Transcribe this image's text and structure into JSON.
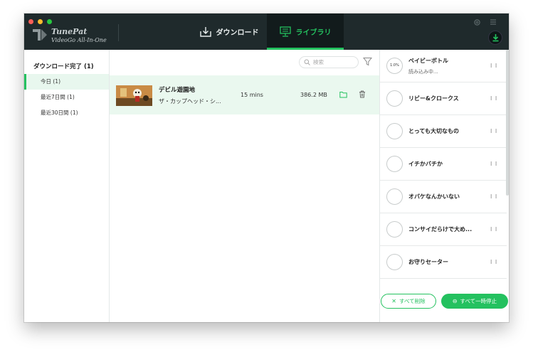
{
  "app": {
    "brand_name": "TunePat",
    "brand_sub": "VideoGo All-In-One"
  },
  "tabs": [
    {
      "label": "ダウンロード",
      "active": false
    },
    {
      "label": "ライブラリ",
      "active": true
    }
  ],
  "sidebar": {
    "title": "ダウンロード完了 (1)",
    "items": [
      {
        "label": "今日 (1)",
        "active": true
      },
      {
        "label": "最近7日間 (1)",
        "active": false
      },
      {
        "label": "最近30日間 (1)",
        "active": false
      }
    ]
  },
  "search": {
    "placeholder": "検索"
  },
  "library": {
    "rows": [
      {
        "title": "デビル遊園地",
        "subtitle": "ザ・カップヘッド・シ...",
        "duration": "15 mins",
        "size": "386.2 MB"
      }
    ]
  },
  "queue": {
    "items": [
      {
        "title": "ベイビーボトル",
        "status": "読み込み中...",
        "progress": "1.0%"
      },
      {
        "title": "リビー&クロークス",
        "status": "",
        "progress": ""
      },
      {
        "title": "とっても大切なもの",
        "status": "",
        "progress": ""
      },
      {
        "title": "イチかバチか",
        "status": "",
        "progress": ""
      },
      {
        "title": "オバケなんかいない",
        "status": "",
        "progress": ""
      },
      {
        "title": "コンサイだらけで大め...",
        "status": "",
        "progress": ""
      },
      {
        "title": "お守りセーター",
        "status": "",
        "progress": ""
      }
    ],
    "pause_glyph": "I I",
    "delete_all_label": "すべて削除",
    "pause_all_label": "すべて一時停止"
  },
  "colors": {
    "accent": "#24c15f",
    "titlebar": "#1f2a2c",
    "active_row_bg": "#eaf8ef"
  }
}
